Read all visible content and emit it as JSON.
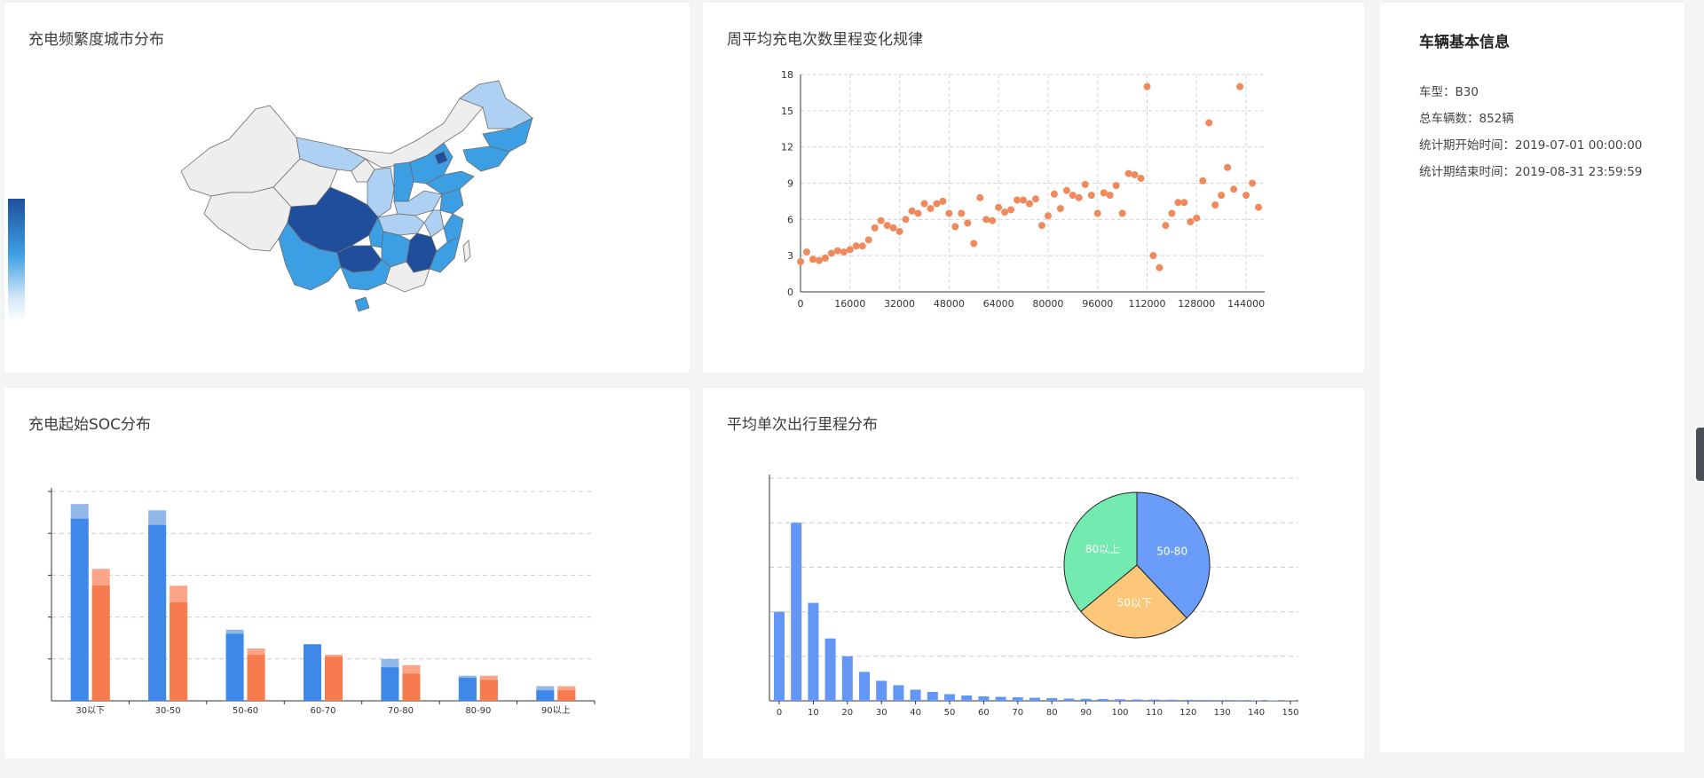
{
  "panels": {
    "map_title": "充电频繁度城市分布",
    "scatter_title": "周平均充电次数里程变化规律",
    "soc_title": "充电起始SOC分布",
    "trip_title": "平均单次出行里程分布"
  },
  "info": {
    "title": "车辆基本信息",
    "rows": [
      "车型：B30",
      "总车辆数：852辆",
      "统计期开始时间：2019-07-01 00:00:00",
      "统计期结束时间：2019-08-31 23:59:59"
    ]
  },
  "colors": {
    "map_dark": "#1f4f9c",
    "map_mid": "#3d9fe3",
    "map_light": "#aed0f3",
    "map_none": "#eeeeee",
    "scatter": "#f08a5d",
    "soc_blue": "#3f87e8",
    "soc_blue_light": "#93b7e9",
    "soc_orange": "#f67b4e",
    "soc_orange_light": "#fba487",
    "hist": "#6497f5",
    "pie_5080": "#6a9cf9",
    "pie_50below": "#fcc779",
    "pie_80above": "#73eab0"
  },
  "chart_data": [
    {
      "id": "map",
      "type": "heatmap",
      "title": "充电频繁度城市分布",
      "legend": "left continuous color scale (white to dark blue), no labels"
    },
    {
      "id": "scatter",
      "type": "scatter",
      "title": "周平均充电次数里程变化规律",
      "xlim": [
        0,
        150000
      ],
      "ylim": [
        0,
        18
      ],
      "xticks": [
        0,
        16000,
        32000,
        48000,
        64000,
        80000,
        96000,
        112000,
        128000,
        144000
      ],
      "yticks": [
        0,
        3,
        6,
        9,
        12,
        15,
        18
      ],
      "grid": true,
      "points": [
        [
          0,
          2.5
        ],
        [
          2000,
          3.3
        ],
        [
          4000,
          2.7
        ],
        [
          6000,
          2.6
        ],
        [
          8000,
          2.8
        ],
        [
          10000,
          3.2
        ],
        [
          12000,
          3.4
        ],
        [
          14000,
          3.3
        ],
        [
          16000,
          3.5
        ],
        [
          18000,
          3.8
        ],
        [
          20000,
          3.8
        ],
        [
          22000,
          4.3
        ],
        [
          24000,
          5.3
        ],
        [
          26000,
          5.9
        ],
        [
          28000,
          5.5
        ],
        [
          30000,
          5.3
        ],
        [
          32000,
          5.0
        ],
        [
          34000,
          6.0
        ],
        [
          36000,
          6.7
        ],
        [
          38000,
          6.5
        ],
        [
          40000,
          7.3
        ],
        [
          42000,
          6.9
        ],
        [
          44000,
          7.3
        ],
        [
          46000,
          7.5
        ],
        [
          48000,
          6.5
        ],
        [
          50000,
          5.4
        ],
        [
          52000,
          6.5
        ],
        [
          54000,
          5.7
        ],
        [
          56000,
          4.0
        ],
        [
          58000,
          7.8
        ],
        [
          60000,
          6.0
        ],
        [
          62000,
          5.9
        ],
        [
          64000,
          7.0
        ],
        [
          66000,
          6.6
        ],
        [
          68000,
          6.8
        ],
        [
          70000,
          7.6
        ],
        [
          72000,
          7.6
        ],
        [
          74000,
          7.3
        ],
        [
          76000,
          7.7
        ],
        [
          78000,
          5.5
        ],
        [
          80000,
          6.3
        ],
        [
          82000,
          8.1
        ],
        [
          84000,
          6.9
        ],
        [
          86000,
          8.4
        ],
        [
          88000,
          8.0
        ],
        [
          90000,
          7.8
        ],
        [
          92000,
          8.9
        ],
        [
          94000,
          8.0
        ],
        [
          96000,
          6.5
        ],
        [
          98000,
          8.2
        ],
        [
          100000,
          8.0
        ],
        [
          102000,
          8.8
        ],
        [
          104000,
          6.5
        ],
        [
          106000,
          9.8
        ],
        [
          108000,
          9.7
        ],
        [
          110000,
          9.4
        ],
        [
          112000,
          17.0
        ],
        [
          114000,
          3.0
        ],
        [
          116000,
          2.0
        ],
        [
          118000,
          5.5
        ],
        [
          120000,
          6.5
        ],
        [
          122000,
          7.4
        ],
        [
          124000,
          7.4
        ],
        [
          126000,
          5.8
        ],
        [
          128000,
          6.1
        ],
        [
          130000,
          9.2
        ],
        [
          132000,
          14.0
        ],
        [
          134000,
          7.2
        ],
        [
          136000,
          8.0
        ],
        [
          138000,
          10.3
        ],
        [
          140000,
          8.5
        ],
        [
          142000,
          17.0
        ],
        [
          144000,
          8.0
        ],
        [
          146000,
          9.0
        ],
        [
          148000,
          7.0
        ]
      ]
    },
    {
      "id": "soc",
      "type": "bar",
      "title": "充电起始SOC分布",
      "categories": [
        "30以下",
        "30-50",
        "50-60",
        "60-70",
        "70-80",
        "80-90",
        "90以上"
      ],
      "ylim": [
        0,
        50
      ],
      "grid": true,
      "series": [
        {
          "values": [
            47,
            45.5,
            17,
            13.5,
            10,
            6,
            3.5
          ]
        },
        {
          "values": [
            31.5,
            27.5,
            12.5,
            11,
            8.5,
            6,
            3.5
          ]
        },
        {
          "values": [
            43.5,
            42,
            16,
            13.5,
            8,
            5.5,
            2.5
          ]
        },
        {
          "values": [
            27.5,
            23.5,
            11,
            10.5,
            6.5,
            5,
            2.5
          ]
        }
      ]
    },
    {
      "id": "trip",
      "type": "bar",
      "title": "平均单次出行里程分布",
      "categories": [
        0,
        5,
        10,
        15,
        20,
        25,
        30,
        35,
        40,
        45,
        50,
        55,
        60,
        65,
        70,
        75,
        80,
        85,
        90,
        95,
        100,
        105,
        110,
        115,
        120,
        125,
        130,
        135,
        140,
        145,
        150
      ],
      "xticks": [
        0,
        10,
        20,
        30,
        40,
        50,
        60,
        70,
        80,
        90,
        100,
        110,
        120,
        130,
        140,
        150
      ],
      "values": [
        20,
        40,
        22,
        14,
        10,
        6.5,
        4.5,
        3.5,
        2.5,
        2,
        1.5,
        1.2,
        1,
        0.9,
        0.8,
        0.7,
        0.6,
        0.5,
        0.45,
        0.4,
        0.35,
        0.3,
        0.28,
        0.25,
        0.22,
        0.2,
        0.18,
        0.15,
        0.12,
        0.1,
        0.08
      ],
      "ylim": [
        0,
        50
      ],
      "grid": true
    },
    {
      "id": "trip_pie",
      "type": "pie",
      "labels": [
        "50-80",
        "50以下",
        "80以上"
      ],
      "values": [
        38,
        26,
        36
      ]
    }
  ]
}
